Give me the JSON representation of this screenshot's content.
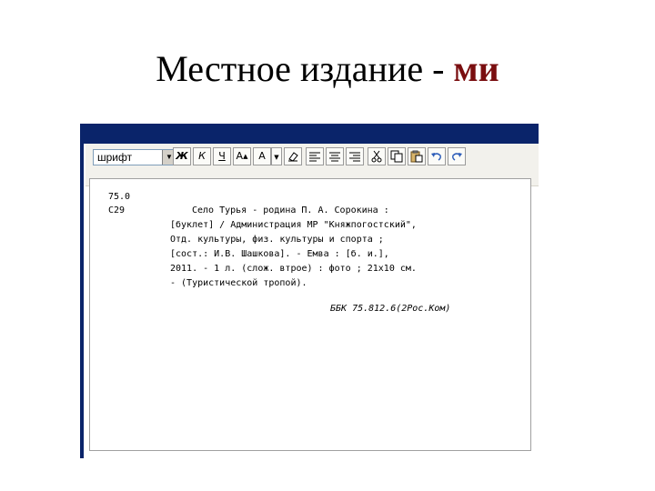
{
  "slide": {
    "title_main": "Местное издание - ",
    "title_accent": "ми"
  },
  "colors": {
    "title_bar": "#0a246a",
    "accent": "#7a0e10",
    "toolbar_bg": "#f2f1ec"
  },
  "toolbar": {
    "font_select_value": "шрифт",
    "bold_label": "Ж",
    "italic_label": "К",
    "underline_label": "Ч",
    "font_size_label": "A",
    "font_color_label": "A",
    "buttons": [
      "bold",
      "italic",
      "underline",
      "font-size",
      "font-color",
      "eraser",
      "align-left",
      "align-center",
      "align-right",
      "cut",
      "copy",
      "paste",
      "undo",
      "redo"
    ]
  },
  "record": {
    "class_code": "75.0",
    "author_code": "С29",
    "lines": [
      "Село Турья - родина П. А. Сорокина :",
      "[буклет] / Администрация МР \"Княжпогостский\",",
      "Отд. культуры, физ. культуры и спорта ;",
      "[сост.: И.В. Шашкова]. - Емва : [б. и.],",
      "2011. - 1 л. (слож. втрое) : фото ; 21х10 см.",
      "- (Туристической тропой)."
    ],
    "bbk": "ББК 75.812.6(2Рос.Ком)"
  }
}
